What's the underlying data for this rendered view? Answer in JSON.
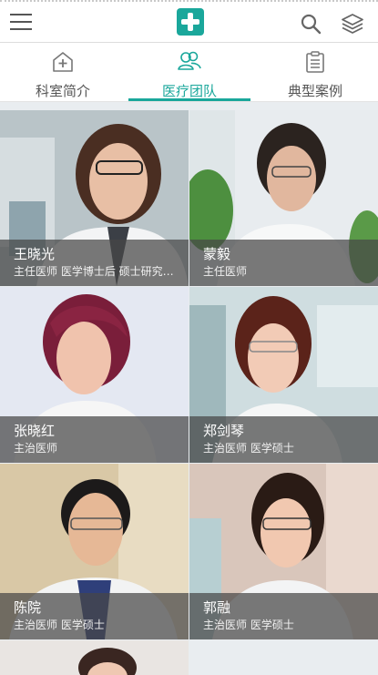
{
  "header": {
    "menu_icon": "hamburger-menu-icon",
    "logo_icon": "medical-cross-logo",
    "search_icon": "search-icon",
    "layers_icon": "layers-icon",
    "accent_color": "#1aa79b"
  },
  "tabs": [
    {
      "label": "科室简介",
      "icon": "hospital-icon",
      "active": false
    },
    {
      "label": "医疗团队",
      "icon": "team-icon",
      "active": true
    },
    {
      "label": "典型案例",
      "icon": "clipboard-icon",
      "active": false
    }
  ],
  "doctors": [
    {
      "name": "王晓光",
      "title": "主任医师 医学博士后 硕士研究生导师"
    },
    {
      "name": "蒙毅",
      "title": "主任医师"
    },
    {
      "name": "张晓红",
      "title": "主治医师"
    },
    {
      "name": "郑剑琴",
      "title": "主治医师 医学硕士"
    },
    {
      "name": "陈院",
      "title": "主治医师 医学硕士"
    },
    {
      "name": "郭融",
      "title": "主治医师 医学硕士"
    }
  ]
}
